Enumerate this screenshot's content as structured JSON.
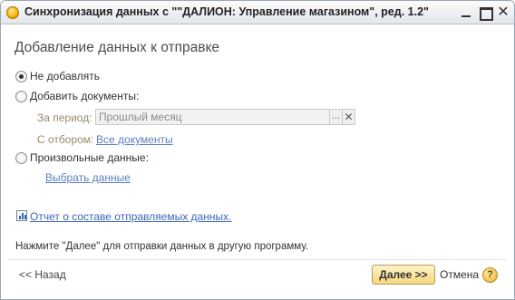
{
  "window": {
    "title": "Синхронизация данных с \"\"ДАЛИОН: Управление магазином\", ред. 1.2\"",
    "minimize_icon": "minimize-icon",
    "maximize_icon": "maximize-icon",
    "close_symbol": "✕"
  },
  "heading": "Добавление данных к отправке",
  "options": {
    "no_add": {
      "label": "Не добавлять",
      "checked": true
    },
    "add_docs": {
      "label": "Добавить документы:",
      "checked": false
    },
    "custom": {
      "label": "Произвольные данные:",
      "checked": false
    }
  },
  "period": {
    "label": "За период:",
    "value": "Прошлый месяц",
    "select_symbol": "...",
    "clear_symbol": "✕"
  },
  "filter": {
    "label": "С отбором:",
    "link": "Все документы"
  },
  "choose_data_link": "Выбрать данные",
  "report_link": "Отчет о составе отправляемых данных.",
  "hint": "Нажмите \"Далее\" для отправки данных в другую программу.",
  "buttons": {
    "back": "<< Назад",
    "next": "Далее >>",
    "cancel": "Отмена",
    "help": "?"
  },
  "colors": {
    "accent_link": "#3c66b5",
    "next_button": "#f5d77f"
  }
}
